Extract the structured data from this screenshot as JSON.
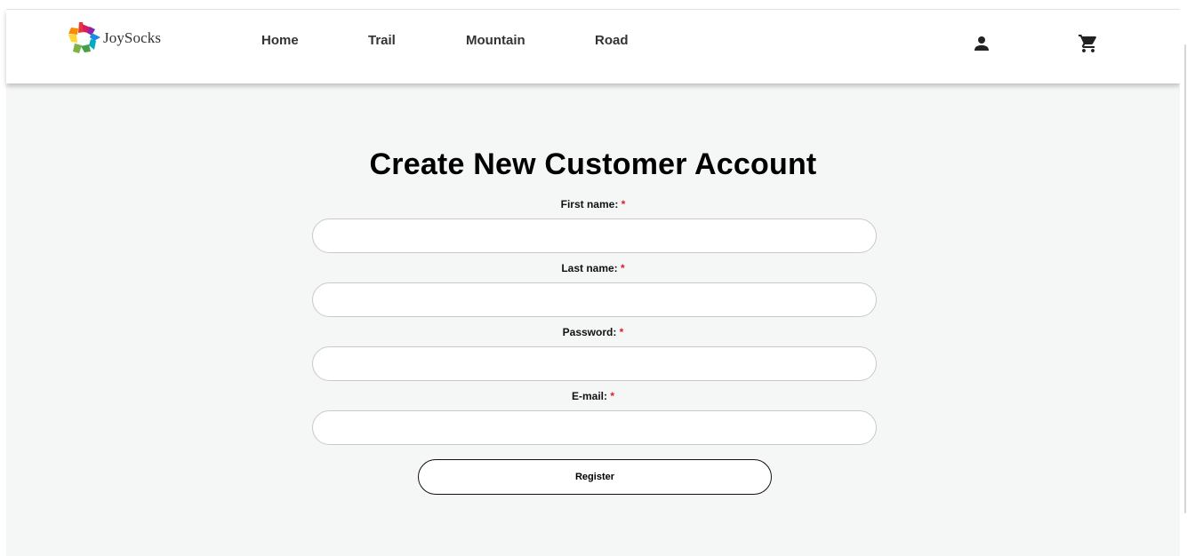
{
  "brand": {
    "name": "JoySocks",
    "logo_icon": "multicolor-star-logo"
  },
  "nav": {
    "items": [
      {
        "label": "Home"
      },
      {
        "label": "Trail"
      },
      {
        "label": "Mountain"
      },
      {
        "label": "Road"
      }
    ],
    "account_icon": "person-icon",
    "cart_icon": "shopping-cart-icon"
  },
  "form": {
    "title": "Create New Customer Account",
    "required_marker": "*",
    "fields": [
      {
        "label": "First name:",
        "value": "",
        "placeholder": ""
      },
      {
        "label": "Last name:",
        "value": "",
        "placeholder": ""
      },
      {
        "label": "Password:",
        "value": "",
        "placeholder": ""
      },
      {
        "label": "E-mail:",
        "value": "",
        "placeholder": ""
      }
    ],
    "submit_label": "Register"
  },
  "colors": {
    "background": "#f5f6f6",
    "header": "#ffffff",
    "required": "#e01e1e",
    "text": "#333333"
  }
}
